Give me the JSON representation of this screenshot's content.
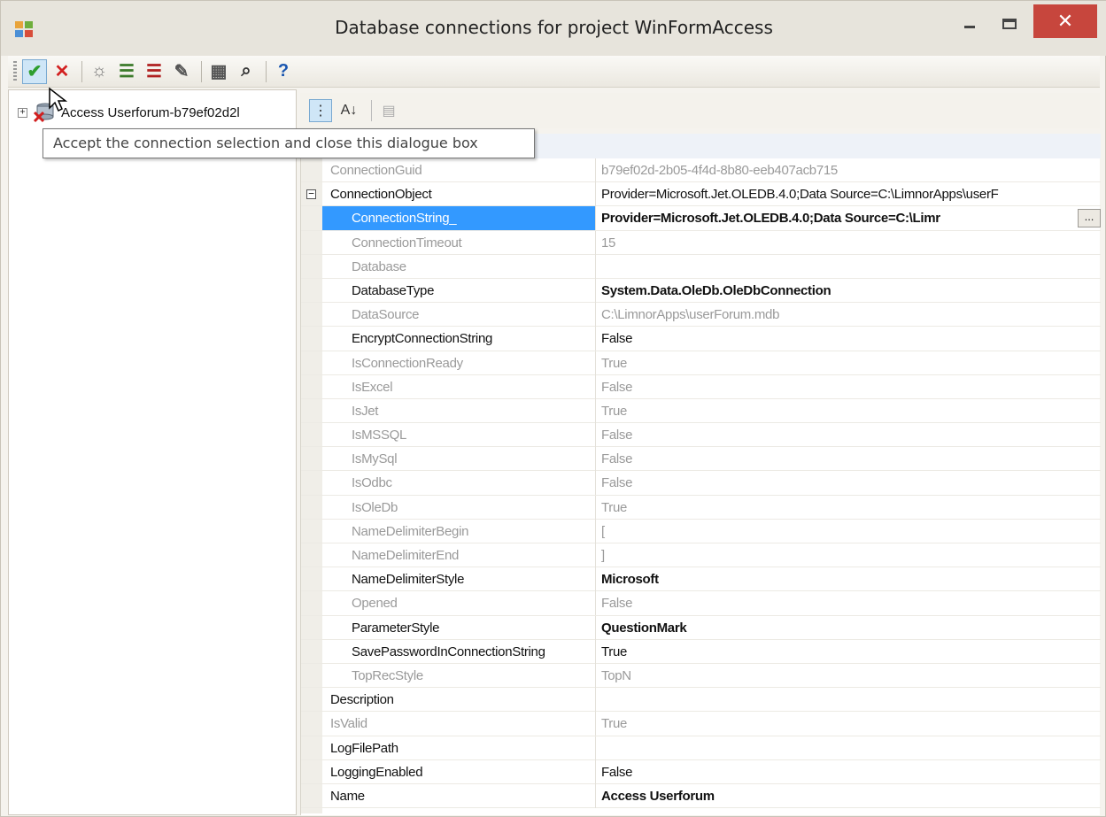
{
  "window": {
    "title": "Database connections for project WinFormAccess",
    "close_glyph": "✕"
  },
  "toolbar": {
    "buttons": [
      {
        "name": "accept-button",
        "icon": "check-icon",
        "glyph": "✔",
        "color": "#2e9e2e",
        "active": true
      },
      {
        "name": "cancel-button",
        "icon": "red-x-icon",
        "glyph": "✕",
        "color": "#d22020"
      },
      {
        "sep": true
      },
      {
        "name": "new-connection-button",
        "icon": "lightbulb-icon",
        "glyph": "☼",
        "color": "#777777"
      },
      {
        "name": "test-connection-button",
        "icon": "list-check-icon",
        "glyph": "☰",
        "color": "#3b7a2a"
      },
      {
        "name": "remove-connection-button",
        "icon": "list-delete-icon",
        "glyph": "☰",
        "color": "#b02020"
      },
      {
        "name": "wizard-button",
        "icon": "magic-wand-icon",
        "glyph": "✎",
        "color": "#555555"
      },
      {
        "sep": true
      },
      {
        "name": "query-builder-button",
        "icon": "query-icon",
        "glyph": "▦",
        "color": "#555555"
      },
      {
        "name": "find-button",
        "icon": "binoculars-icon",
        "glyph": "⌕",
        "color": "#333333"
      },
      {
        "sep": true
      },
      {
        "name": "help-button",
        "icon": "help-icon",
        "glyph": "?",
        "color": "#1a56b0"
      }
    ]
  },
  "tree": {
    "node_label": "Access Userforum-b79ef02d2l",
    "expander": "+"
  },
  "tooltip": {
    "text": "Accept the connection selection and close this dialogue box"
  },
  "property_toolbar": {
    "categorized_glyph": "⋮",
    "alphabetical_glyph": "A↓",
    "pages_glyph": "▤"
  },
  "properties": [
    {
      "name": "ConnectionGuid",
      "value": "b79ef02d-2b05-4f4d-8b80-eeb407acb715",
      "indent": 0,
      "name_style": "ro",
      "value_style": "ro"
    },
    {
      "name": "ConnectionObject",
      "value": "Provider=Microsoft.Jet.OLEDB.4.0;Data Source=C:\\LimnorApps\\userF",
      "indent": 0,
      "name_style": "rw",
      "value_style": "rw",
      "expander": "−"
    },
    {
      "name": "ConnectionString_",
      "value": "Provider=Microsoft.Jet.OLEDB.4.0;Data Source=C:\\Limr",
      "indent": 1,
      "name_style": "rw",
      "value_style": "bold",
      "selected": true,
      "ellipsis": "..."
    },
    {
      "name": "ConnectionTimeout",
      "value": "15",
      "indent": 1,
      "name_style": "ro",
      "value_style": "ro"
    },
    {
      "name": "Database",
      "value": "",
      "indent": 1,
      "name_style": "ro",
      "value_style": "ro"
    },
    {
      "name": "DatabaseType",
      "value": "System.Data.OleDb.OleDbConnection",
      "indent": 1,
      "name_style": "rw",
      "value_style": "bold"
    },
    {
      "name": "DataSource",
      "value": "C:\\LimnorApps\\userForum.mdb",
      "indent": 1,
      "name_style": "ro",
      "value_style": "ro"
    },
    {
      "name": "EncryptConnectionString",
      "value": "False",
      "indent": 1,
      "name_style": "rw",
      "value_style": "rw"
    },
    {
      "name": "IsConnectionReady",
      "value": "True",
      "indent": 1,
      "name_style": "ro",
      "value_style": "ro"
    },
    {
      "name": "IsExcel",
      "value": "False",
      "indent": 1,
      "name_style": "ro",
      "value_style": "ro"
    },
    {
      "name": "IsJet",
      "value": "True",
      "indent": 1,
      "name_style": "ro",
      "value_style": "ro"
    },
    {
      "name": "IsMSSQL",
      "value": "False",
      "indent": 1,
      "name_style": "ro",
      "value_style": "ro"
    },
    {
      "name": "IsMySql",
      "value": "False",
      "indent": 1,
      "name_style": "ro",
      "value_style": "ro"
    },
    {
      "name": "IsOdbc",
      "value": "False",
      "indent": 1,
      "name_style": "ro",
      "value_style": "ro"
    },
    {
      "name": "IsOleDb",
      "value": "True",
      "indent": 1,
      "name_style": "ro",
      "value_style": "ro"
    },
    {
      "name": "NameDelimiterBegin",
      "value": "[",
      "indent": 1,
      "name_style": "ro",
      "value_style": "ro"
    },
    {
      "name": "NameDelimiterEnd",
      "value": "]",
      "indent": 1,
      "name_style": "ro",
      "value_style": "ro"
    },
    {
      "name": "NameDelimiterStyle",
      "value": "Microsoft",
      "indent": 1,
      "name_style": "rw",
      "value_style": "bold"
    },
    {
      "name": "Opened",
      "value": "False",
      "indent": 1,
      "name_style": "ro",
      "value_style": "ro"
    },
    {
      "name": "ParameterStyle",
      "value": "QuestionMark",
      "indent": 1,
      "name_style": "rw",
      "value_style": "bold"
    },
    {
      "name": "SavePasswordInConnectionString",
      "value": "True",
      "indent": 1,
      "name_style": "rw",
      "value_style": "rw"
    },
    {
      "name": "TopRecStyle",
      "value": "TopN",
      "indent": 1,
      "name_style": "ro",
      "value_style": "ro"
    },
    {
      "name": "Description",
      "value": "",
      "indent": 0,
      "name_style": "rw",
      "value_style": "rw"
    },
    {
      "name": "IsValid",
      "value": "True",
      "indent": 0,
      "name_style": "ro",
      "value_style": "ro"
    },
    {
      "name": "LogFilePath",
      "value": "",
      "indent": 0,
      "name_style": "rw",
      "value_style": "rw"
    },
    {
      "name": "LoggingEnabled",
      "value": "False",
      "indent": 0,
      "name_style": "rw",
      "value_style": "rw"
    },
    {
      "name": "Name",
      "value": "Access Userforum",
      "indent": 0,
      "name_style": "rw",
      "value_style": "bold"
    }
  ]
}
